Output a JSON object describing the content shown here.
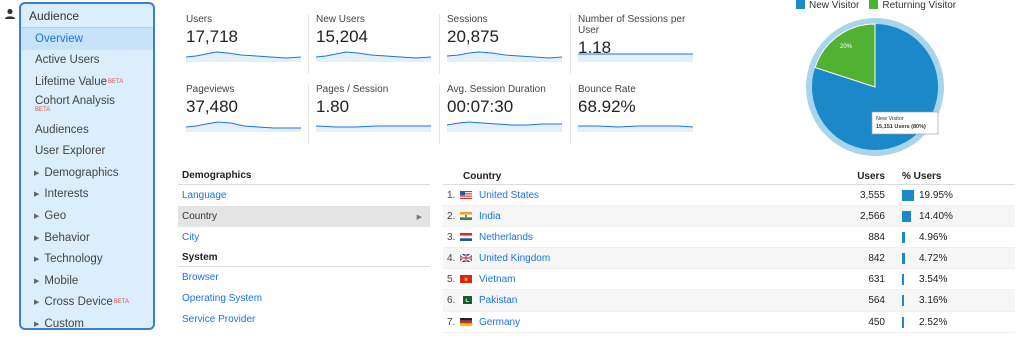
{
  "sidebar": {
    "header": "Audience",
    "items": [
      {
        "label": "Overview",
        "active": true
      },
      {
        "label": "Active Users"
      },
      {
        "label": "Lifetime Value",
        "beta": "BETA"
      },
      {
        "label": "Cohort Analysis",
        "beta_under": "BETA"
      },
      {
        "label": "Audiences"
      },
      {
        "label": "User Explorer"
      },
      {
        "label": "Demographics",
        "caret": true
      },
      {
        "label": "Interests",
        "caret": true
      },
      {
        "label": "Geo",
        "caret": true
      },
      {
        "label": "Behavior",
        "caret": true
      },
      {
        "label": "Technology",
        "caret": true
      },
      {
        "label": "Mobile",
        "caret": true
      },
      {
        "label": "Cross Device",
        "caret": true,
        "beta": "BETA"
      },
      {
        "label": "Custom",
        "caret": true
      }
    ]
  },
  "metrics": [
    {
      "label": "Users",
      "value": "17,718"
    },
    {
      "label": "New Users",
      "value": "15,204"
    },
    {
      "label": "Sessions",
      "value": "20,875"
    },
    {
      "label": "Number of Sessions per User",
      "value": "1.18"
    },
    {
      "label": "Pageviews",
      "value": "37,480"
    },
    {
      "label": "Pages / Session",
      "value": "1.80"
    },
    {
      "label": "Avg. Session Duration",
      "value": "00:07:30"
    },
    {
      "label": "Bounce Rate",
      "value": "68.92%"
    }
  ],
  "pie": {
    "legend": [
      "New Visitor",
      "Returning Visitor"
    ],
    "colors": {
      "new": "#1a88c9",
      "returning": "#4fb233",
      "ring": "#a8d4ec"
    },
    "new_fraction": 0.8,
    "returning_label": "20%",
    "tooltip_line1": "New Visitor",
    "tooltip_line2": "15,151 Users (80%)"
  },
  "demographics": {
    "header": "Demographics",
    "items": [
      "Language",
      "Country",
      "City"
    ],
    "selected": "Country",
    "system_header": "System",
    "system_items": [
      "Browser",
      "Operating System",
      "Service Provider"
    ]
  },
  "country_table": {
    "col_country": "Country",
    "col_users": "Users",
    "col_pct": "% Users",
    "rows": [
      {
        "num": "1.",
        "country": "United States",
        "users": "3,555",
        "pct": "19.95%",
        "share": 19.95,
        "flag": "us"
      },
      {
        "num": "2.",
        "country": "India",
        "users": "2,566",
        "pct": "14.40%",
        "share": 14.4,
        "flag": "in"
      },
      {
        "num": "3.",
        "country": "Netherlands",
        "users": "884",
        "pct": "4.96%",
        "share": 4.96,
        "flag": "nl"
      },
      {
        "num": "4.",
        "country": "United Kingdom",
        "users": "842",
        "pct": "4.72%",
        "share": 4.72,
        "flag": "gb"
      },
      {
        "num": "5.",
        "country": "Vietnam",
        "users": "631",
        "pct": "3.54%",
        "share": 3.54,
        "flag": "vn"
      },
      {
        "num": "6.",
        "country": "Pakistan",
        "users": "564",
        "pct": "3.16%",
        "share": 3.16,
        "flag": "pk"
      },
      {
        "num": "7.",
        "country": "Germany",
        "users": "450",
        "pct": "2.52%",
        "share": 2.52,
        "flag": "de"
      }
    ]
  }
}
